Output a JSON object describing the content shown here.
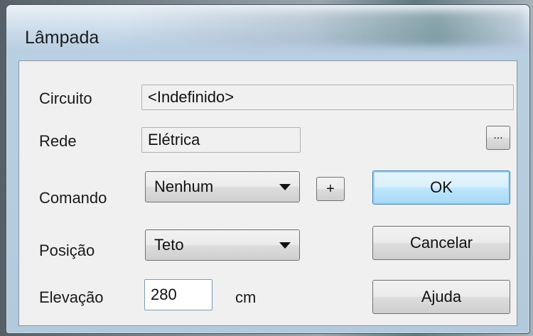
{
  "window": {
    "title": "Lâmpada"
  },
  "form": {
    "circuito_label": "Circuito",
    "circuito_value": "<Indefinido>",
    "rede_label": "Rede",
    "rede_value": "Elétrica",
    "browse_label": "...",
    "comando_label": "Comando",
    "comando_value": "Nenhum",
    "add_label": "+",
    "posicao_label": "Posição",
    "posicao_value": "Teto",
    "elevacao_label": "Elevação",
    "elevacao_value": "280",
    "elevacao_unit": "cm"
  },
  "buttons": {
    "ok": "OK",
    "cancel": "Cancelar",
    "help": "Ajuda"
  },
  "icons": [
    "dropdown-arrow-icon"
  ],
  "colors": {
    "default_button_border": "#3c7fb1",
    "default_button_fill": "#bee6fd",
    "client_bg": "#f0f0f0"
  }
}
